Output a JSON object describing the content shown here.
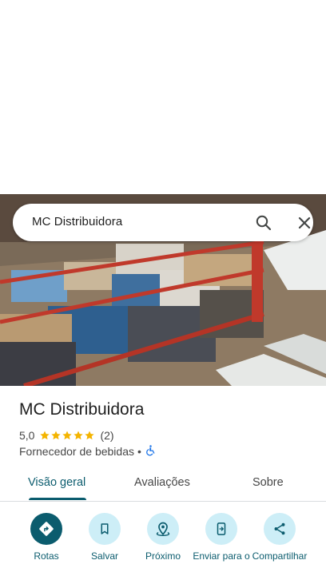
{
  "search": {
    "query": "MC Distribuidora"
  },
  "place": {
    "name": "MC Distribuidora",
    "rating": "5,0",
    "rating_stars": 5,
    "review_count": "(2)",
    "category": "Fornecedor de bebidas",
    "separator": "•",
    "accessibility_icon": "wheelchair-icon"
  },
  "tabs": [
    {
      "label": "Visão geral",
      "active": true
    },
    {
      "label": "Avaliações",
      "active": false
    },
    {
      "label": "Sobre",
      "active": false
    }
  ],
  "actions": [
    {
      "label": "Rotas",
      "icon": "directions-icon"
    },
    {
      "label": "Salvar",
      "icon": "bookmark-icon"
    },
    {
      "label": "Próximo",
      "icon": "nearby-icon"
    },
    {
      "label": "Enviar para o",
      "icon": "send-to-phone-icon"
    },
    {
      "label": "Compartilhar",
      "icon": "share-icon"
    }
  ],
  "colors": {
    "accent": "#0b5c6e",
    "action_bg": "#cdeef7",
    "star": "#f4b400",
    "wheelchair": "#1a73e8"
  }
}
